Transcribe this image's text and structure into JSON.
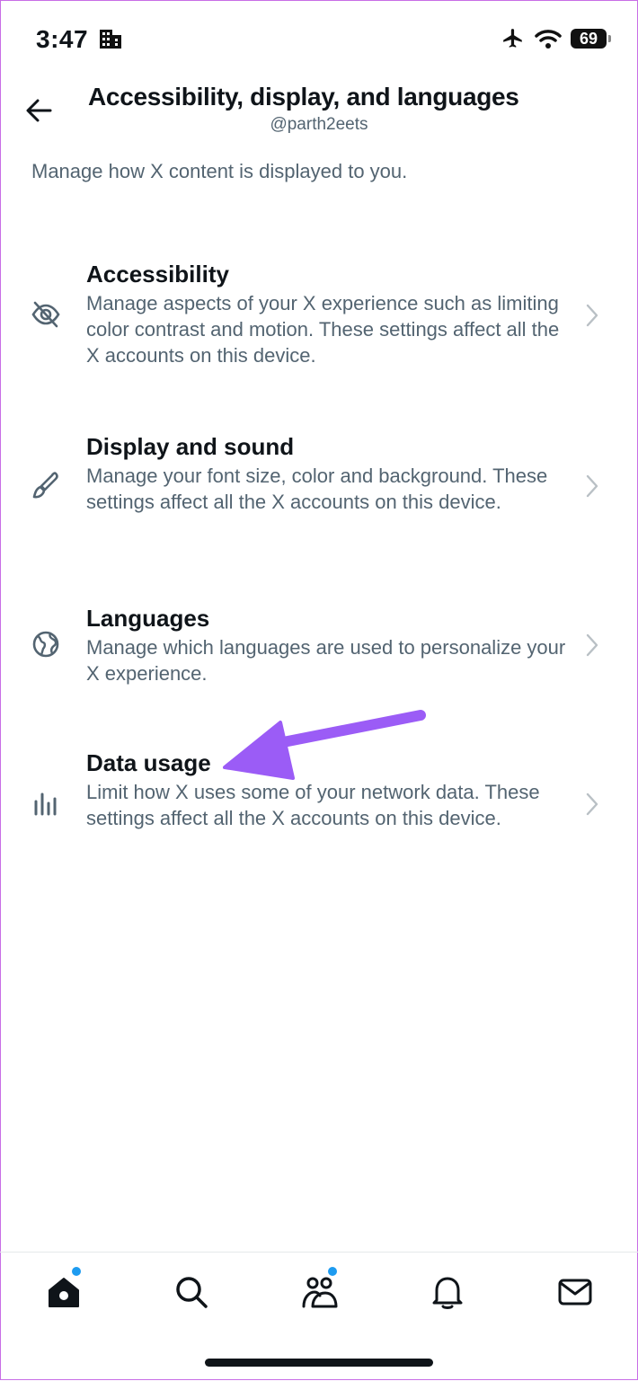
{
  "status_bar": {
    "time": "3:47",
    "battery": "69"
  },
  "header": {
    "title": "Accessibility, display, and languages",
    "handle": "@parth2eets"
  },
  "intro": "Manage how X content is displayed to you.",
  "items": [
    {
      "title": "Accessibility",
      "description": "Manage aspects of your X experience such as limiting color contrast and motion. These settings affect all the X accounts on this device.",
      "icon": "eye-off-icon"
    },
    {
      "title": "Display and sound",
      "description": "Manage your font size, color and background. These settings affect all the X accounts on this device.",
      "icon": "paintbrush-icon"
    },
    {
      "title": "Languages",
      "description": "Manage which languages are used to personalize your X experience.",
      "icon": "globe-icon"
    },
    {
      "title": "Data usage",
      "description": "Limit how X uses some of your network data. These settings affect all the X accounts on this device.",
      "icon": "bar-chart-icon"
    }
  ],
  "annotation": {
    "arrow_color": "#9b5cf6"
  },
  "tab_bar": {
    "tabs": [
      "home-icon",
      "search-icon",
      "communities-icon",
      "notifications-icon",
      "messages-icon"
    ],
    "accent_dot_color": "#1d9bf0"
  }
}
